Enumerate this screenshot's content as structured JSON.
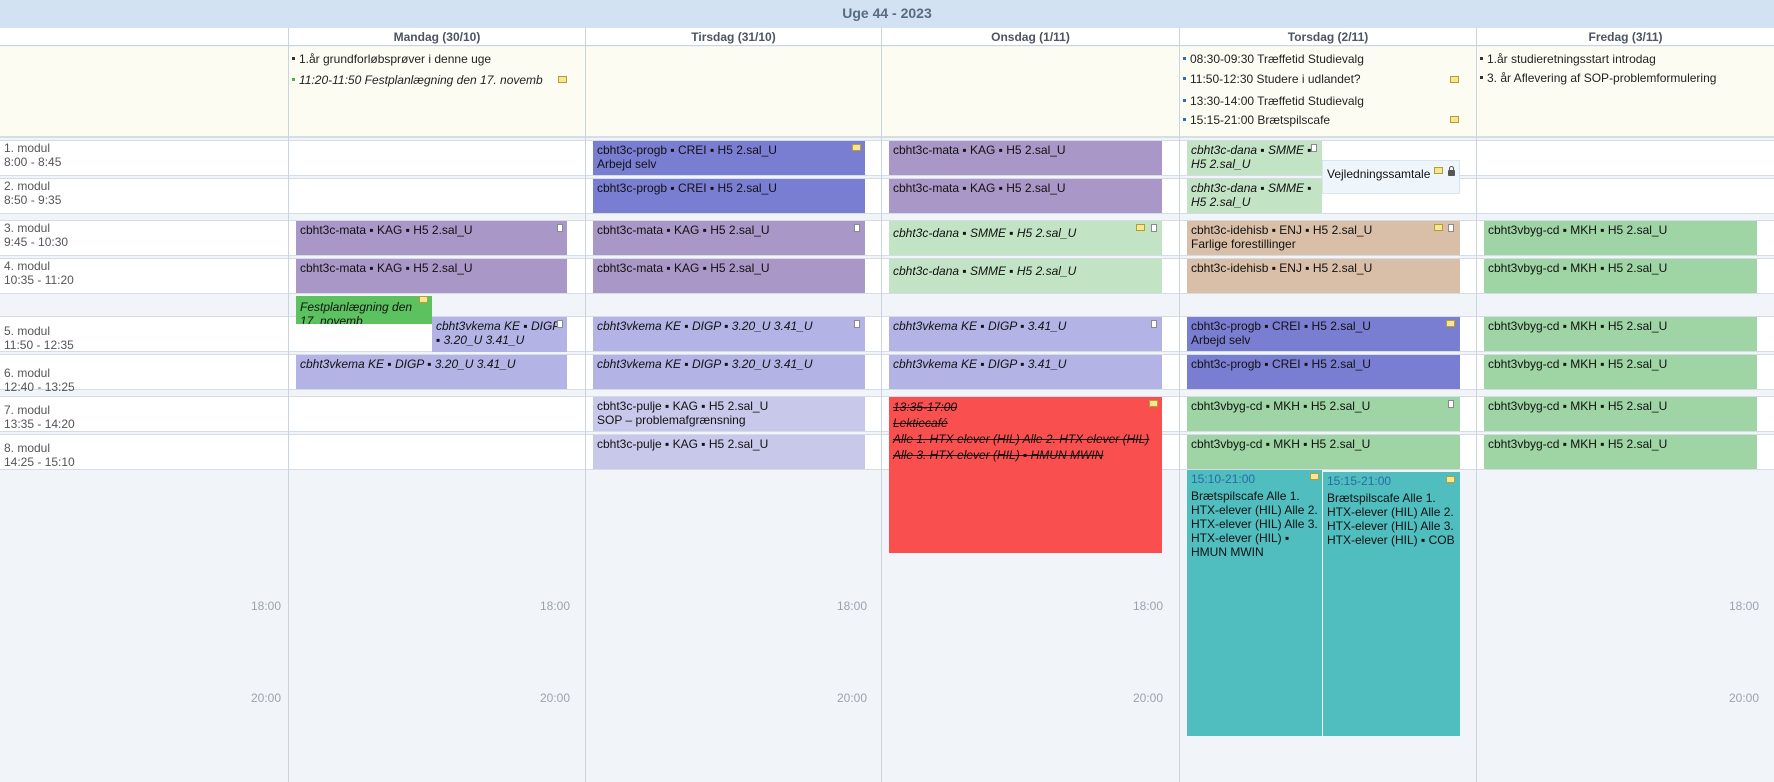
{
  "week_title": "Uge 44 - 2023",
  "days": [
    {
      "label": "Mandag (30/10)"
    },
    {
      "label": "Tirsdag (31/10)"
    },
    {
      "label": "Onsdag (1/11)"
    },
    {
      "label": "Torsdag (2/11)"
    },
    {
      "label": "Fredag (3/11)"
    }
  ],
  "allday": {
    "mon": [
      "1.år grundforløbsprøver i denne uge",
      "11:20-11:50 Festplanlægning den 17. novemb"
    ],
    "thu": [
      "08:30-09:30 Træffetid Studievalg",
      "11:50-12:30 Studere i udlandet?",
      "13:30-14:00 Træffetid Studievalg",
      "15:15-21:00 Brætspilscafe"
    ],
    "fri": [
      "1.år studieretningsstart introdag",
      "3. år Aflevering af SOP-problemformulering"
    ]
  },
  "modules": [
    {
      "name": "1. modul",
      "time": "8:00 - 8:45"
    },
    {
      "name": "2. modul",
      "time": "8:50 - 9:35"
    },
    {
      "name": "3. modul",
      "time": "9:45 - 10:30"
    },
    {
      "name": "4. modul",
      "time": "10:35 - 11:20"
    },
    {
      "name": "5. modul",
      "time": "11:50 - 12:35"
    },
    {
      "name": "6. modul",
      "time": "12:40 - 13:25"
    },
    {
      "name": "7. modul",
      "time": "13:35 - 14:20"
    },
    {
      "name": "8. modul",
      "time": "14:25 - 15:10"
    }
  ],
  "time_labels": {
    "t18": "18:00",
    "t20": "20:00"
  },
  "events": {
    "mon_mata3": "cbht3c-mata ▪ KAG ▪ H5 2.sal_U",
    "mon_mata4": "cbht3c-mata ▪ KAG ▪ H5 2.sal_U",
    "mon_fest": "Festplanlægning den 17. novemb",
    "mon_kema5": "cbht3vkema KE ▪ DIGP ▪ 3.20_U 3.41_U",
    "mon_kema6": "cbht3vkema KE ▪ DIGP ▪ 3.20_U 3.41_U",
    "tue_progb1_a": "cbht3c-progb ▪ CREI ▪ H5 2.sal_U",
    "tue_progb1_b": "Arbejd selv",
    "tue_progb2": "cbht3c-progb ▪ CREI ▪ H5 2.sal_U",
    "tue_mata3": "cbht3c-mata ▪ KAG ▪ H5 2.sal_U",
    "tue_mata4": "cbht3c-mata ▪ KAG ▪ H5 2.sal_U",
    "tue_kema5": "cbht3vkema KE ▪ DIGP ▪ 3.20_U 3.41_U",
    "tue_kema6": "cbht3vkema KE ▪ DIGP ▪ 3.20_U 3.41_U",
    "tue_pulje7_a": "cbht3c-pulje ▪ KAG ▪ H5 2.sal_U",
    "tue_pulje7_b": "SOP – problemafgrænsning",
    "tue_pulje8": "cbht3c-pulje ▪ KAG ▪ H5 2.sal_U",
    "wed_mata1": "cbht3c-mata ▪ KAG ▪ H5 2.sal_U",
    "wed_mata2": "cbht3c-mata ▪ KAG ▪ H5 2.sal_U",
    "wed_dana3": "cbht3c-dana ▪ SMME ▪ H5 2.sal_U",
    "wed_dana4": "cbht3c-dana ▪ SMME ▪ H5 2.sal_U",
    "wed_kema5": "cbht3vkema KE ▪ DIGP ▪ 3.41_U",
    "wed_kema6": "cbht3vkema KE ▪ DIGP ▪ 3.41_U",
    "wed_lekt_time": "13:35-17:00",
    "wed_lekt_title": "Lektiecafé",
    "wed_lekt_desc": "Alle 1. HTX elever (HIL) Alle 2. HTX elever (HIL) Alle 3. HTX elever (HIL) ▪ HMUN MWIN",
    "thu_dana1": "cbht3c-dana ▪ SMME ▪ H5 2.sal_U",
    "thu_dana2": "cbht3c-dana ▪ SMME ▪ H5 2.sal_U",
    "thu_vej": "Vejledningssamtale",
    "thu_ide3_a": "cbht3c-idehisb ▪ ENJ ▪ H5 2.sal_U",
    "thu_ide3_b": "Farlige forestillinger",
    "thu_ide4": "cbht3c-idehisb ▪ ENJ ▪ H5 2.sal_U",
    "thu_progb5_a": "cbht3c-progb ▪ CREI ▪ H5 2.sal_U",
    "thu_progb5_b": "Arbejd selv",
    "thu_progb6": "cbht3c-progb ▪ CREI ▪ H5 2.sal_U",
    "thu_vbyg7": "cbht3vbyg-cd ▪ MKH ▪ H5 2.sal_U",
    "thu_vbyg8": "cbht3vbyg-cd ▪ MKH ▪ H5 2.sal_U",
    "thu_brat1_time": "15:10-21:00",
    "thu_brat1_desc": "Brætspilscafe Alle 1. HTX-elever (HIL) Alle 2. HTX-elever (HIL) Alle 3. HTX-elever (HIL) ▪ HMUN MWIN",
    "thu_brat2_time": "15:15-21:00",
    "thu_brat2_desc": "Brætspilscafe Alle 1. HTX-elever (HIL) Alle 2. HTX-elever (HIL) Alle 3. HTX-elever (HIL) ▪ COB",
    "fri_vbyg3": "cbht3vbyg-cd ▪ MKH ▪ H5 2.sal_U",
    "fri_vbyg4": "cbht3vbyg-cd ▪ MKH ▪ H5 2.sal_U",
    "fri_vbyg5": "cbht3vbyg-cd ▪ MKH ▪ H5 2.sal_U",
    "fri_vbyg6": "cbht3vbyg-cd ▪ MKH ▪ H5 2.sal_U",
    "fri_vbyg7": "cbht3vbyg-cd ▪ MKH ▪ H5 2.sal_U",
    "fri_vbyg8": "cbht3vbyg-cd ▪ MKH ▪ H5 2.sal_U"
  }
}
